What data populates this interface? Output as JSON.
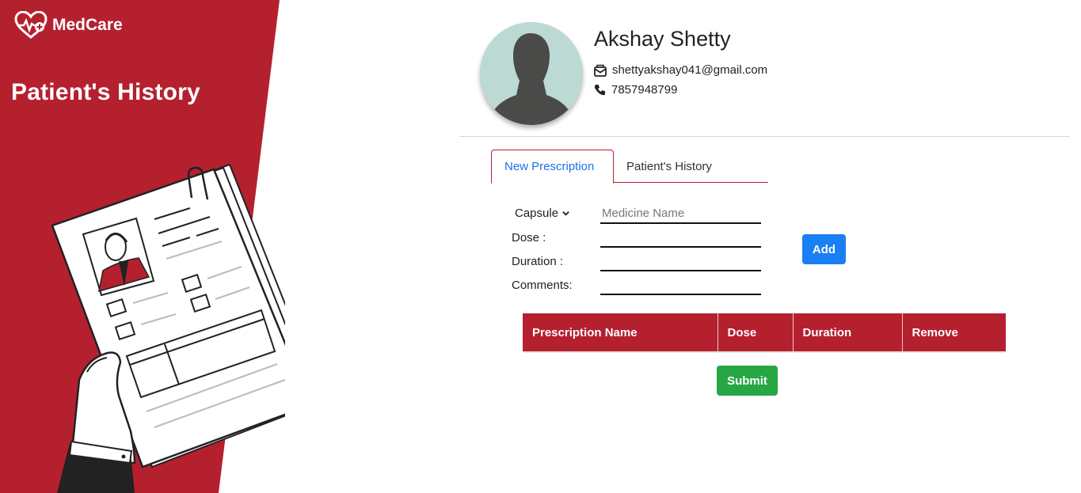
{
  "brand": {
    "name": "MedCare"
  },
  "left_panel": {
    "title": "Patient's History",
    "color": "#b5202f"
  },
  "profile": {
    "name": "Akshay Shetty",
    "email": "shettyakshay041@gmail.com",
    "phone": "7857948799"
  },
  "tabs": [
    {
      "label": "New Prescription",
      "active": true
    },
    {
      "label": "Patient's History",
      "active": false
    }
  ],
  "form": {
    "type_select": {
      "selected": "Capsule"
    },
    "medicine_name": {
      "placeholder": "Medicine Name",
      "value": ""
    },
    "dose_label": "Dose :",
    "duration_label": "Duration :",
    "comments_label": "Comments:",
    "add_label": "Add"
  },
  "table": {
    "headers": [
      "Prescription Name",
      "Dose",
      "Duration",
      "Remove"
    ]
  },
  "submit_label": "Submit",
  "colors": {
    "accent": "#b5202f",
    "primary": "#1a7ff2",
    "success": "#27a744"
  }
}
